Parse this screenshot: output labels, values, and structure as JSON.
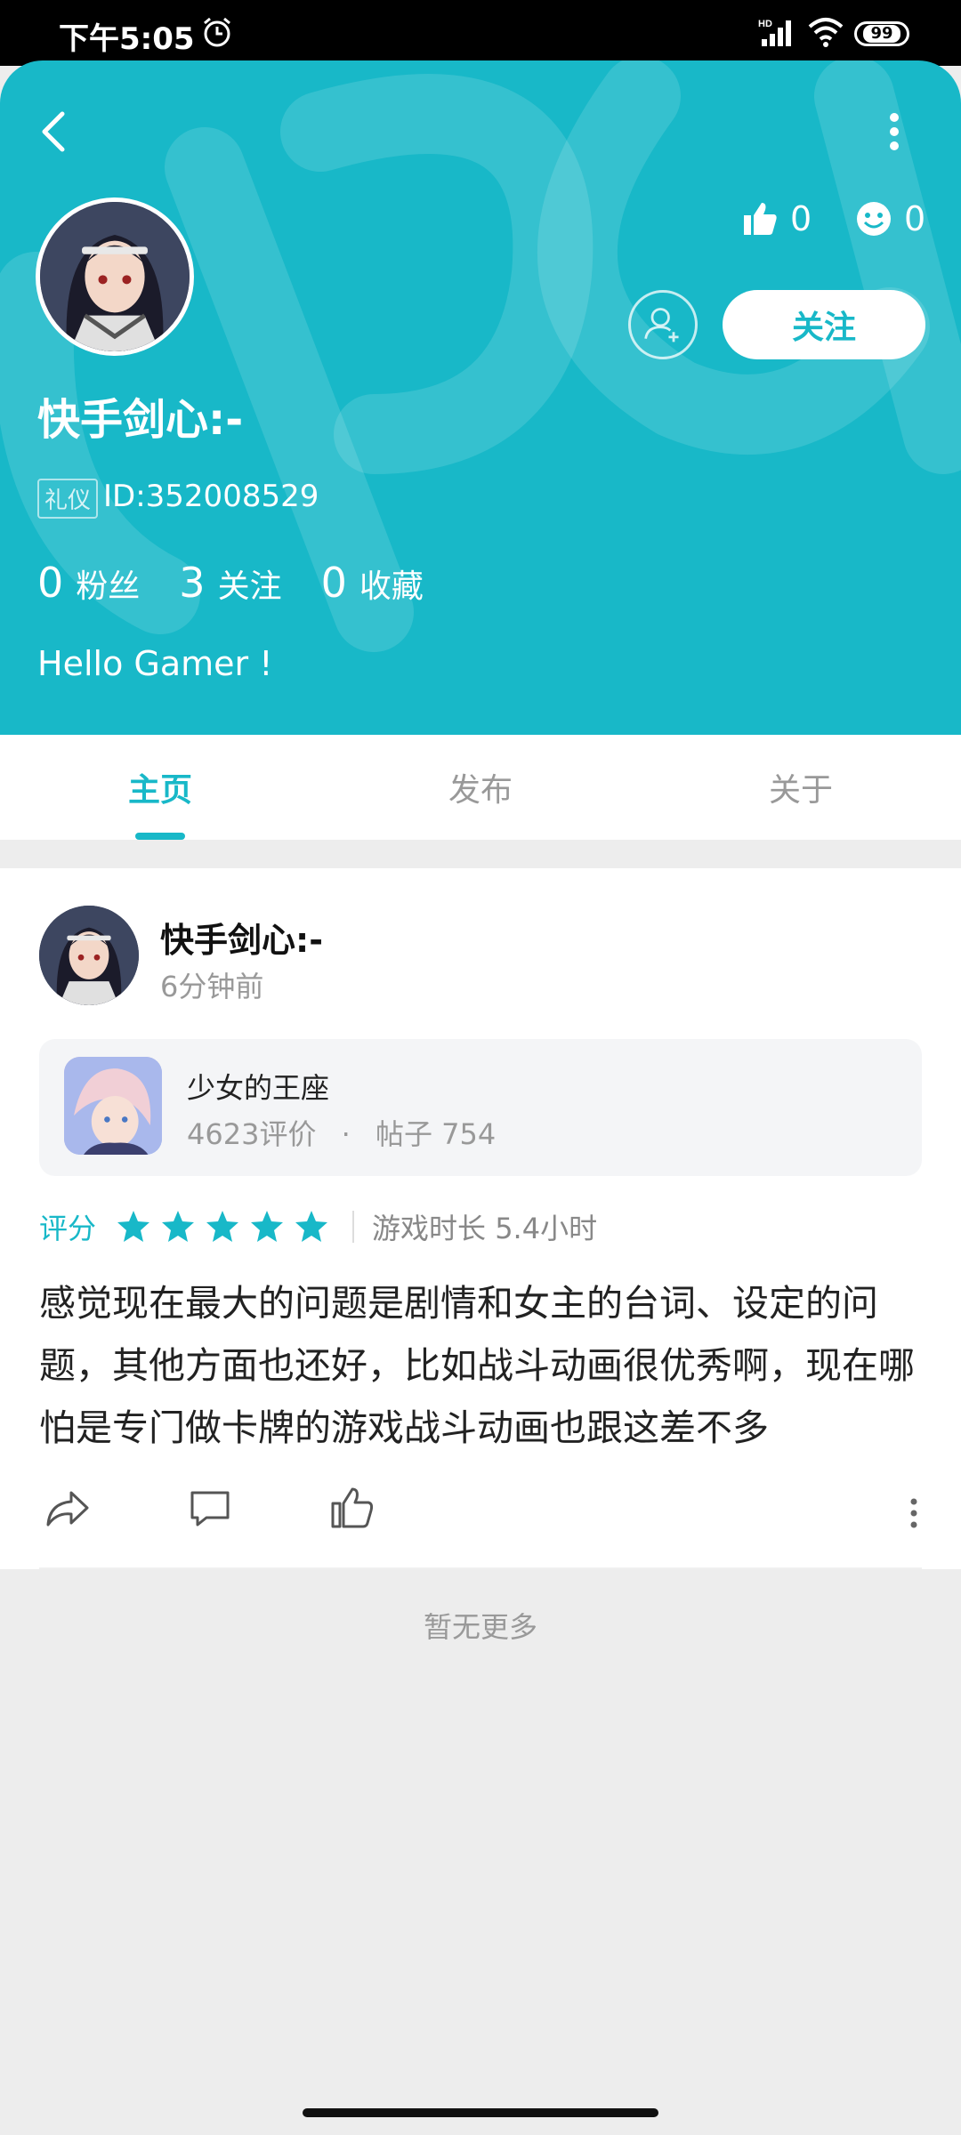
{
  "status_bar": {
    "time": "下午5:05",
    "battery": "99"
  },
  "profile": {
    "username": "快手剑心:-",
    "badge": "礼仪",
    "id": "ID:352008529",
    "likes": "0",
    "smiles": "0",
    "follow_label": "关注",
    "stats": [
      {
        "num": "0",
        "label": "粉丝"
      },
      {
        "num": "3",
        "label": "关注"
      },
      {
        "num": "0",
        "label": "收藏"
      }
    ],
    "bio": "Hello Gamer !"
  },
  "tabs": [
    "主页",
    "发布",
    "关于"
  ],
  "active_tab": 0,
  "post": {
    "author": "快手剑心:-",
    "time": "6分钟前",
    "game": {
      "name": "少女的王座",
      "reviews": "4623评价",
      "posts": "帖子 754"
    },
    "rating_label": "评分",
    "rating": 5,
    "playtime": "游戏时长 5.4小时",
    "body": "感觉现在最大的问题是剧情和女主的台词、设定的问题，其他方面也还好，比如战斗动画很优秀啊，现在哪怕是专门做卡牌的游戏战斗动画也跟这差不多"
  },
  "footer": {
    "no_more": "暂无更多"
  },
  "colors": {
    "accent": "#18b8c8"
  }
}
